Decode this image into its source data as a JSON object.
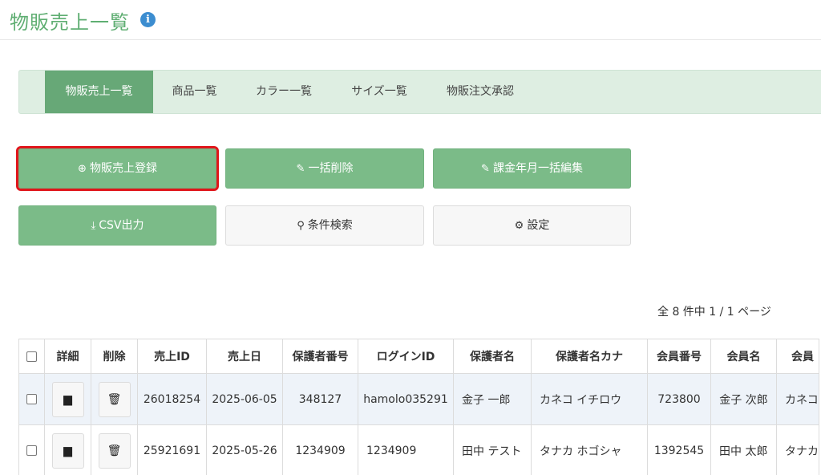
{
  "header": {
    "title": "物販売上一覧",
    "info_icon": "i"
  },
  "tabs": [
    {
      "label": "物販売上一覧",
      "active": true
    },
    {
      "label": "商品一覧"
    },
    {
      "label": "カラー一覧"
    },
    {
      "label": "サイズ一覧"
    },
    {
      "label": "物販注文承認"
    }
  ],
  "actions": {
    "register": "物販売上登録",
    "bulk_delete": "一括削除",
    "bulk_edit_month": "課金年月一括編集",
    "csv_output": "CSV出力",
    "search": "条件検索",
    "settings": "設定"
  },
  "pager": {
    "summary": "全 8 件中 1 / 1 ページ"
  },
  "table": {
    "headers": [
      "詳細",
      "削除",
      "売上ID",
      "売上日",
      "保護者番号",
      "ログインID",
      "保護者名",
      "保護者名カナ",
      "会員番号",
      "会員名",
      "会員"
    ],
    "rows": [
      [
        "26018254",
        "2025-06-05",
        "348127",
        "hamolo035291",
        "金子 一郎",
        "カネコ イチロウ",
        "723800",
        "金子 次郎",
        "カネコ"
      ],
      [
        "25921691",
        "2025-05-26",
        "1234909",
        "1234909",
        "田中 テスト",
        "タナカ ホゴシャ",
        "1392545",
        "田中 太郎",
        "タナカ"
      ]
    ]
  },
  "colors": {
    "accent": "#7bbb88",
    "active_tab": "#67a877",
    "tab_bg": "#deeee2",
    "highlight": "#e0161b",
    "title": "#5fae72"
  }
}
